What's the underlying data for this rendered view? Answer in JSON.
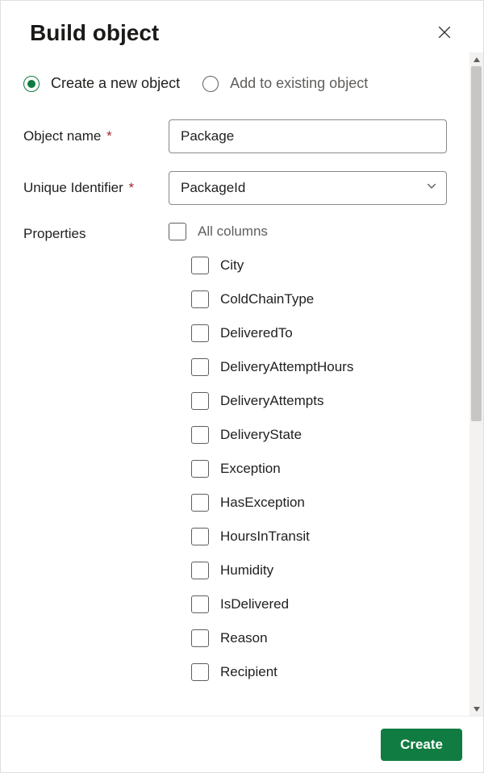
{
  "header": {
    "title": "Build object"
  },
  "mode": {
    "create_label": "Create a new object",
    "add_label": "Add to existing object"
  },
  "fields": {
    "object_name_label": "Object name",
    "object_name_value": "Package",
    "unique_id_label": "Unique Identifier",
    "unique_id_value": "PackageId",
    "properties_label": "Properties"
  },
  "properties": {
    "all_label": "All columns",
    "items": [
      "City",
      "ColdChainType",
      "DeliveredTo",
      "DeliveryAttemptHours",
      "DeliveryAttempts",
      "DeliveryState",
      "Exception",
      "HasException",
      "HoursInTransit",
      "Humidity",
      "IsDelivered",
      "Reason",
      "Recipient"
    ]
  },
  "footer": {
    "create_label": "Create"
  }
}
